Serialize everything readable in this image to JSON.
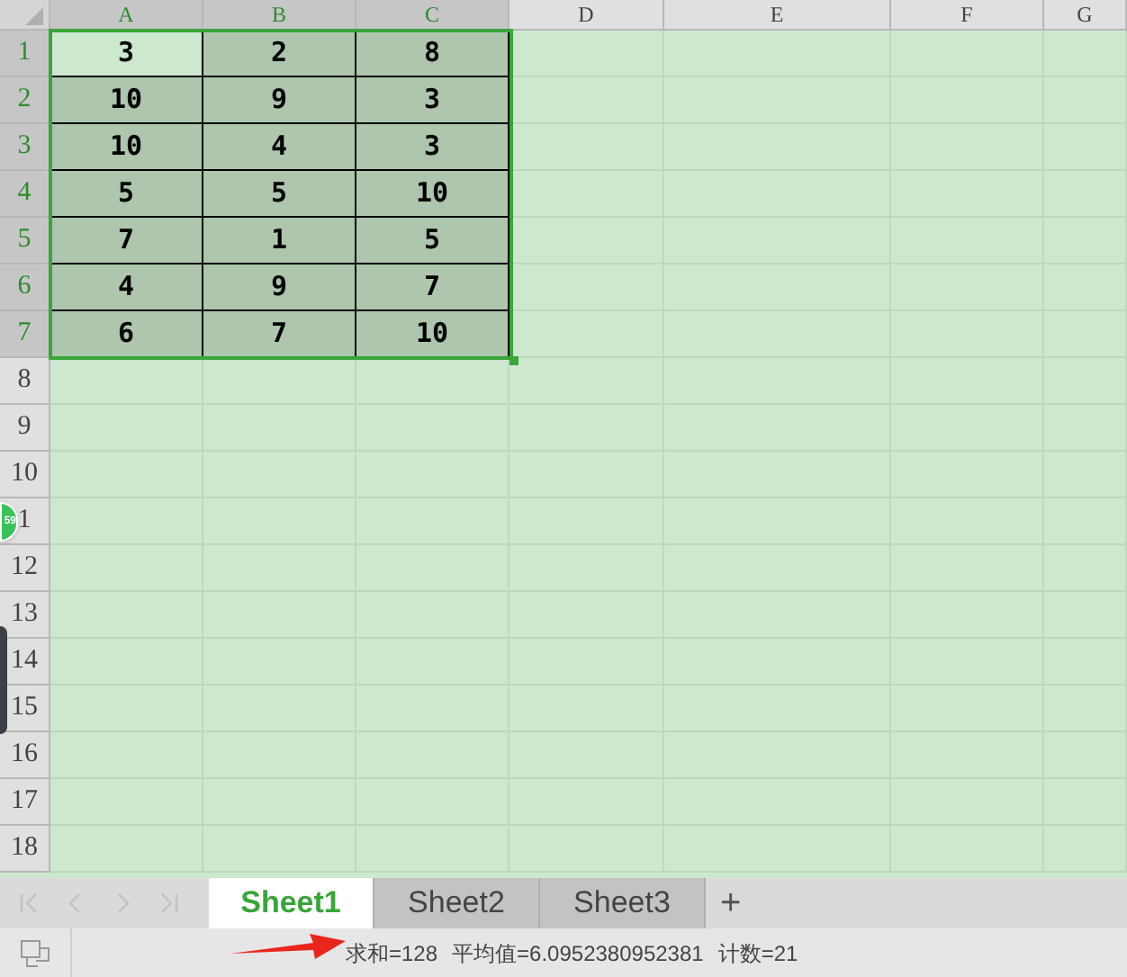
{
  "columns": [
    {
      "label": "A",
      "selected": true
    },
    {
      "label": "B",
      "selected": true
    },
    {
      "label": "C",
      "selected": true
    },
    {
      "label": "D",
      "selected": false
    },
    {
      "label": "E",
      "selected": false
    },
    {
      "label": "F",
      "selected": false
    },
    {
      "label": "G",
      "selected": false
    }
  ],
  "rows": [
    {
      "label": "1",
      "selected": true,
      "cells": [
        {
          "value": "3",
          "selected": true,
          "active": true
        },
        {
          "value": "2",
          "selected": true,
          "active": false
        },
        {
          "value": "8",
          "selected": true,
          "active": false
        }
      ]
    },
    {
      "label": "2",
      "selected": true,
      "cells": [
        {
          "value": "10",
          "selected": true,
          "active": false
        },
        {
          "value": "9",
          "selected": true,
          "active": false
        },
        {
          "value": "3",
          "selected": true,
          "active": false
        }
      ]
    },
    {
      "label": "3",
      "selected": true,
      "cells": [
        {
          "value": "10",
          "selected": true,
          "active": false
        },
        {
          "value": "4",
          "selected": true,
          "active": false
        },
        {
          "value": "3",
          "selected": true,
          "active": false
        }
      ]
    },
    {
      "label": "4",
      "selected": true,
      "cells": [
        {
          "value": "5",
          "selected": true,
          "active": false
        },
        {
          "value": "5",
          "selected": true,
          "active": false
        },
        {
          "value": "10",
          "selected": true,
          "active": false
        }
      ]
    },
    {
      "label": "5",
      "selected": true,
      "cells": [
        {
          "value": "7",
          "selected": true,
          "active": false
        },
        {
          "value": "1",
          "selected": true,
          "active": false
        },
        {
          "value": "5",
          "selected": true,
          "active": false
        }
      ]
    },
    {
      "label": "6",
      "selected": true,
      "cells": [
        {
          "value": "4",
          "selected": true,
          "active": false
        },
        {
          "value": "9",
          "selected": true,
          "active": false
        },
        {
          "value": "7",
          "selected": true,
          "active": false
        }
      ]
    },
    {
      "label": "7",
      "selected": true,
      "cells": [
        {
          "value": "6",
          "selected": true,
          "active": false
        },
        {
          "value": "7",
          "selected": true,
          "active": false
        },
        {
          "value": "10",
          "selected": true,
          "active": false
        }
      ]
    },
    {
      "label": "8",
      "selected": false
    },
    {
      "label": "9",
      "selected": false
    },
    {
      "label": "10",
      "selected": false
    },
    {
      "label": "1",
      "selected": false
    },
    {
      "label": "12",
      "selected": false
    },
    {
      "label": "13",
      "selected": false
    },
    {
      "label": "14",
      "selected": false
    },
    {
      "label": "15",
      "selected": false
    },
    {
      "label": "16",
      "selected": false
    },
    {
      "label": "17",
      "selected": false
    },
    {
      "label": "18",
      "selected": false
    }
  ],
  "floating_badge": "59",
  "sheet_tabs": [
    {
      "label": "Sheet1",
      "selected": true
    },
    {
      "label": "Sheet2",
      "selected": false
    },
    {
      "label": "Sheet3",
      "selected": false
    }
  ],
  "add_sheet": "+",
  "status_bar": {
    "sum": "求和=128",
    "average": "平均值=6.0952380952381",
    "count": "计数=21"
  }
}
